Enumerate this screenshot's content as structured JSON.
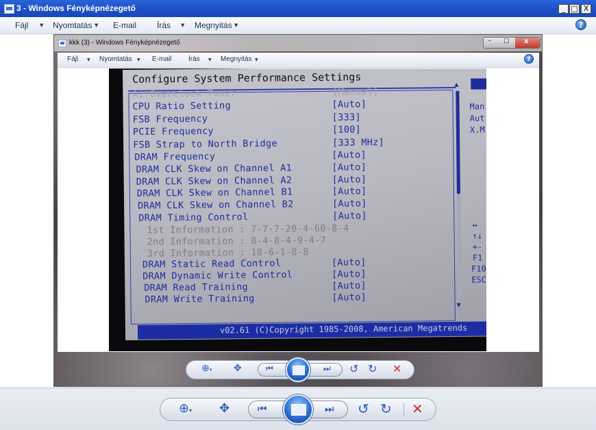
{
  "outer_window": {
    "title": "3 - Windows Fényképnézegető",
    "menu": [
      {
        "label": "Fájl",
        "has_arrow": true
      },
      {
        "label": "Nyomtatás",
        "has_arrow": true
      },
      {
        "label": "E-mail",
        "has_arrow": false
      },
      {
        "label": "Írás",
        "has_arrow": true
      },
      {
        "label": "Megnyitás",
        "has_arrow": true
      }
    ],
    "controls": {
      "minimize": "_",
      "maximize": "□",
      "close": "X"
    },
    "help": "?"
  },
  "inner_window": {
    "title": "kkk (3) - Windows Fényképnézegető",
    "menu": [
      {
        "label": "Fájl",
        "has_arrow": true
      },
      {
        "label": "Nyomtatás",
        "has_arrow": true
      },
      {
        "label": "E-mail",
        "has_arrow": false
      },
      {
        "label": "Írás",
        "has_arrow": true
      },
      {
        "label": "Megnyitás",
        "has_arrow": true
      }
    ],
    "help": "?"
  },
  "photo": {
    "header": "Configure System Performance Settings",
    "rows": [
      {
        "label": "Ai Overclock Tuner",
        "value": "[Manual]",
        "style": "dim"
      },
      {
        "label": "CPU Ratio Setting",
        "value": "[Auto]",
        "style": "normal"
      },
      {
        "label": "FSB Frequency",
        "value": "[333]",
        "style": "normal"
      },
      {
        "label": "PCIE Frequency",
        "value": "[100]",
        "style": "normal"
      },
      {
        "label": "FSB Strap to North Bridge",
        "value": "[333 MHz]",
        "style": "normal"
      },
      {
        "label": "DRAM Frequency",
        "value": "[Auto]",
        "style": "normal"
      },
      {
        "label": "DRAM CLK Skew on Channel A1",
        "value": "[Auto]",
        "style": "normal"
      },
      {
        "label": "DRAM CLK Skew on Channel A2",
        "value": "[Auto]",
        "style": "normal"
      },
      {
        "label": "DRAM CLK Skew on Channel B1",
        "value": "[Auto]",
        "style": "normal"
      },
      {
        "label": "DRAM CLK Skew on Channel B2",
        "value": "[Auto]",
        "style": "normal"
      },
      {
        "label": "DRAM Timing Control",
        "value": "[Auto]",
        "style": "normal"
      },
      {
        "label": "1st Information : 7-7-7-20-4-60-8-4",
        "value": "",
        "style": "info"
      },
      {
        "label": "2nd Information : 8-4-8-4-9-4-7",
        "value": "",
        "style": "info"
      },
      {
        "label": "3rd Information : 18-6-1-8-8",
        "value": "",
        "style": "info"
      },
      {
        "label": "DRAM Static Read Control",
        "value": "[Auto]",
        "style": "normal"
      },
      {
        "label": "DRAM Dynamic Write Control",
        "value": "[Auto]",
        "style": "normal"
      },
      {
        "label": "DRAM Read Training",
        "value": "[Auto]",
        "style": "normal"
      },
      {
        "label": "DRAM Write Training",
        "value": "[Auto]",
        "style": "normal"
      }
    ],
    "right_panel": [
      "Man",
      "Aut",
      "X.M"
    ],
    "right_keys": [
      "↔",
      "↑↓",
      "+-",
      "F1",
      "F10",
      "ESC"
    ],
    "footer": "v02.61 (C)Copyright 1985-2008, American Megatrends"
  },
  "toolbar": {
    "zoom": "zoom-icon",
    "fit": "fit-icon",
    "prev": "prev-icon",
    "slideshow": "slideshow-icon",
    "next": "next-icon",
    "rotate_ccw": "rotate-ccw-icon",
    "rotate_cw": "rotate-cw-icon",
    "delete": "delete-icon"
  }
}
